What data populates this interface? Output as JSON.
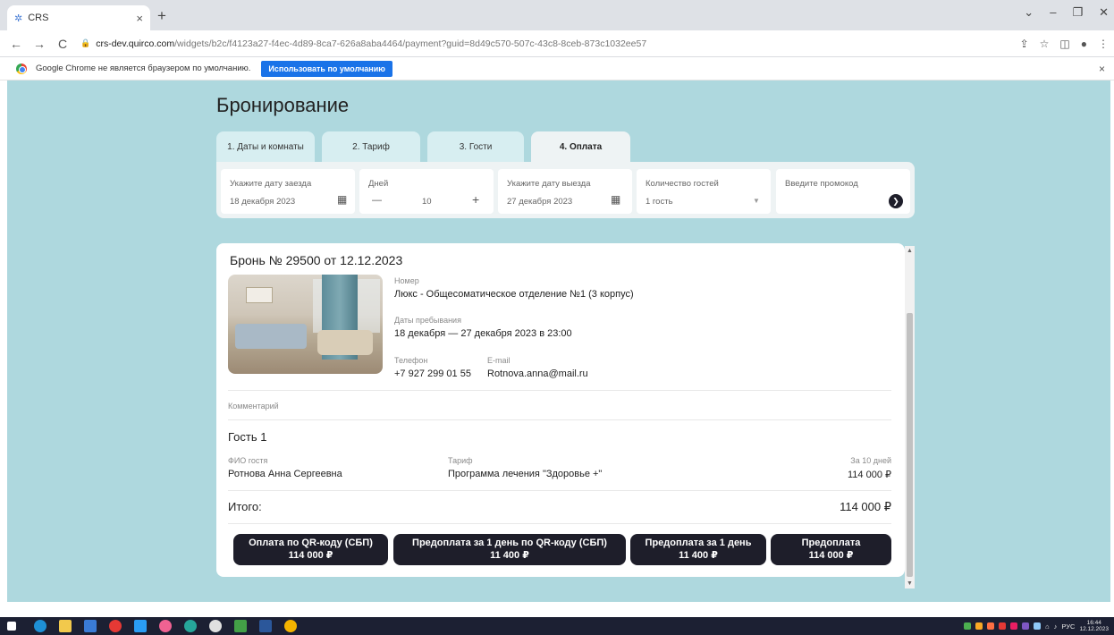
{
  "browser": {
    "tab_title": "CRS",
    "tab_close": "×",
    "new_tab": "+",
    "url_host": "crs-dev.quirco.com",
    "url_path": "/widgets/b2c/f4123a27-f4ec-4d89-8ca7-626a8aba4464/payment?guid=8d49c570-507c-43c8-8ceb-873c1032ee57",
    "infobar_text": "Google Chrome не является браузером по умолчанию.",
    "infobar_button": "Использовать по умолчанию",
    "infobar_close": "×"
  },
  "page": {
    "title": "Бронирование",
    "steps": [
      {
        "label": "1. Даты и комнаты"
      },
      {
        "label": "2. Тариф"
      },
      {
        "label": "3. Гости"
      },
      {
        "label": "4. Оплата"
      }
    ],
    "filters": {
      "checkin_label": "Укажите дату заезда",
      "checkin_value": "18 декабря 2023",
      "days_label": "Дней",
      "days_minus": "—",
      "days_value": "10",
      "days_plus": "+",
      "checkout_label": "Укажите дату выезда",
      "checkout_value": "27 декабря 2023",
      "guests_label": "Количество гостей",
      "guests_value": "1 гость",
      "promo_label": "Введите промокод"
    }
  },
  "booking": {
    "title": "Бронь № 29500 от 12.12.2023",
    "room_label": "Номер",
    "room_value": "Люкс - Общесоматическое отделение №1 (3 корпус)",
    "dates_label": "Даты пребывания",
    "dates_value": "18 декабря — 27 декабря 2023 в 23:00",
    "phone_label": "Телефон",
    "phone_value": "+7 927 299 01 55",
    "email_label": "E-mail",
    "email_value": "Rotnova.anna@mail.ru",
    "comment_label": "Комментарий",
    "guest_heading": "Гость 1",
    "guest_name_label": "ФИО гостя",
    "guest_name_value": "Ротнова Анна Сергеевна",
    "tariff_label": "Тариф",
    "tariff_value": "Программа лечения \"Здоровье +\"",
    "period_label": "За 10 дней",
    "period_value": "114 000 ₽",
    "total_label": "Итого:",
    "total_value": "114 000 ₽",
    "payments": [
      {
        "label": "Оплата по QR-коду (СБП)",
        "amount": "114 000 ₽"
      },
      {
        "label": "Предоплата за 1 день по QR-коду (СБП)",
        "amount": "11 400 ₽"
      },
      {
        "label": "Предоплата за 1 день",
        "amount": "11 400 ₽"
      },
      {
        "label": "Предоплата",
        "amount": "114 000 ₽"
      }
    ]
  },
  "taskbar": {
    "lang": "РУС",
    "time": "16:44",
    "date": "12.12.2023"
  }
}
